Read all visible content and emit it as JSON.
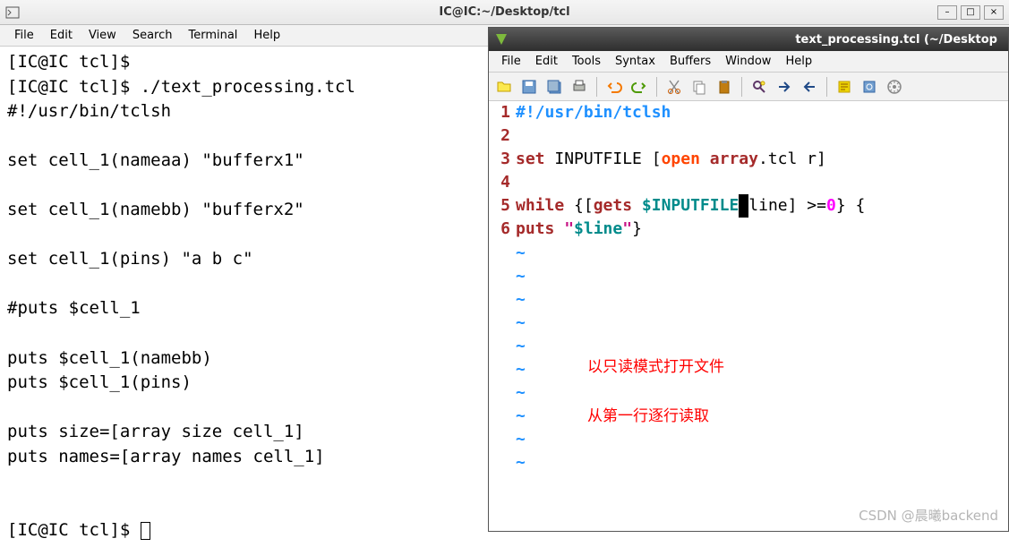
{
  "terminal": {
    "titlebar": "IC@IC:~/Desktop/tcl",
    "menu": [
      "File",
      "Edit",
      "View",
      "Search",
      "Terminal",
      "Help"
    ],
    "lines": [
      "[IC@IC tcl]$",
      "[IC@IC tcl]$ ./text_processing.tcl",
      "#!/usr/bin/tclsh",
      "",
      "set cell_1(nameaa) \"bufferx1\"",
      "",
      "set cell_1(namebb) \"bufferx2\"",
      "",
      "set cell_1(pins) \"a b c\"",
      "",
      "#puts $cell_1",
      "",
      "puts $cell_1(namebb)",
      "puts $cell_1(pins)",
      "",
      "puts size=[array size cell_1]",
      "puts names=[array names cell_1]",
      "",
      "",
      "[IC@IC tcl]$ "
    ]
  },
  "vim": {
    "titlebar": "text_processing.tcl (~/Desktop",
    "menu": [
      "File",
      "Edit",
      "Tools",
      "Syntax",
      "Buffers",
      "Window",
      "Help"
    ],
    "toolbar_icons": [
      "open-folder-icon",
      "save-icon",
      "save-all-icon",
      "print-icon",
      "sep",
      "undo-icon",
      "redo-icon",
      "sep",
      "cut-icon",
      "copy-icon",
      "paste-icon",
      "sep",
      "find-replace-icon",
      "arrow-right-icon",
      "arrow-left-icon",
      "sep",
      "script-icon",
      "make-icon",
      "shell-icon"
    ],
    "code": {
      "shebang": "#!/usr/bin/tclsh",
      "set": "set",
      "inputfile": "INPUTFILE [",
      "open": "open",
      "array": "array",
      "tcl_r": ".tcl r]",
      "while": "while",
      "gets_open": " {[",
      "gets": "gets",
      "var_inputfile": "$INPUTFILE",
      "line_post": "line] >=",
      "zero": "0",
      "close": "} {",
      "puts": "puts",
      "str_open": "\"",
      "str_line": "$line",
      "str_close": "\"",
      "brace_close": "}"
    },
    "line_numbers": [
      "1",
      "2",
      "3",
      "4",
      "5",
      "6"
    ],
    "tildes": [
      "~",
      "~",
      "~",
      "~",
      "~",
      "~",
      "~",
      "~",
      "~",
      "~"
    ],
    "annotations": {
      "note1": "以只读模式打开文件",
      "note2": "从第一行逐行读取"
    }
  },
  "watermark": "CSDN @晨曦backend"
}
